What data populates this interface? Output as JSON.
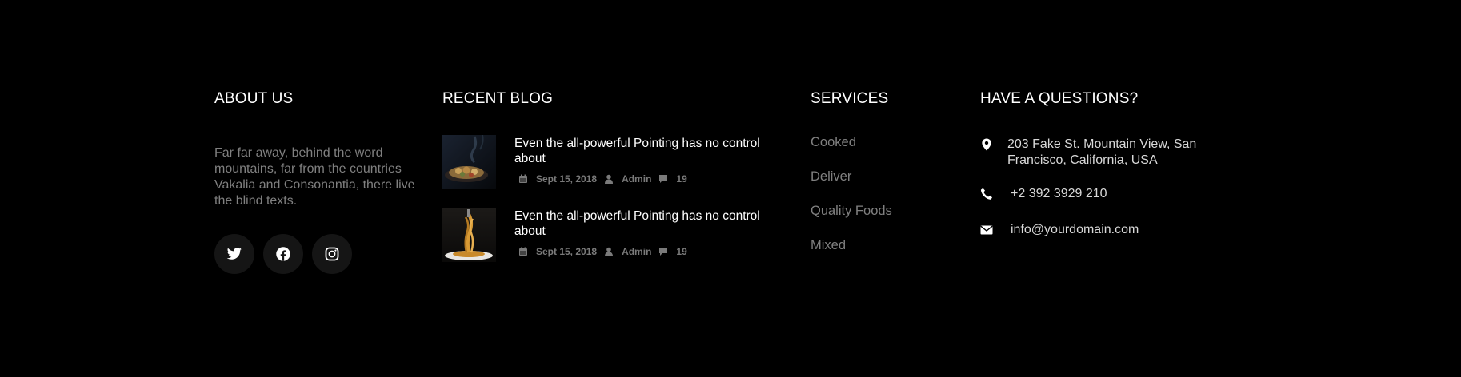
{
  "about": {
    "heading": "ABOUT US",
    "text": "Far far away, behind the word mountains, far from the countries Vakalia and Consonantia, there live the blind texts.",
    "socials": [
      {
        "icon": "twitter-icon"
      },
      {
        "icon": "facebook-icon"
      },
      {
        "icon": "instagram-icon"
      }
    ]
  },
  "blog": {
    "heading": "RECENT BLOG",
    "entries": [
      {
        "title": "Even the all-powerful Pointing has no control about",
        "date": "Sept 15, 2018",
        "author": "Admin",
        "comments": "19"
      },
      {
        "title": "Even the all-powerful Pointing has no control about",
        "date": "Sept 15, 2018",
        "author": "Admin",
        "comments": "19"
      }
    ]
  },
  "services": {
    "heading": "SERVICES",
    "items": [
      "Cooked",
      "Deliver",
      "Quality Foods",
      "Mixed"
    ]
  },
  "contact": {
    "heading": "HAVE A QUESTIONS?",
    "address": "203 Fake St. Mountain View, San Francisco, California, USA",
    "phone": "+2 392 3929 210",
    "email": "info@yourdomain.com"
  },
  "colors": {
    "background": "#000000",
    "heading": "#ffffff",
    "muted_text": "#808080",
    "social_bg": "#151515"
  }
}
